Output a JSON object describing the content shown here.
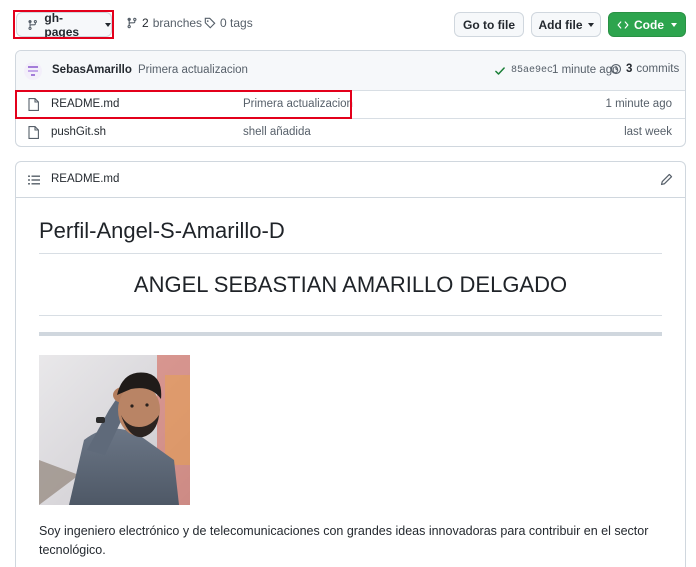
{
  "toolbar": {
    "branch": "gh-pages",
    "branches_count": "2",
    "branches_label": "branches",
    "tags_label": "0 tags",
    "go_to_file": "Go to file",
    "add_file": "Add file",
    "code": "Code"
  },
  "commit": {
    "author": "SebasAmarillo",
    "message": "Primera actualizacion",
    "hash": "85ae9ec",
    "time": "1 minute ago",
    "commits_count": "3",
    "commits_label": "commits"
  },
  "files": [
    {
      "name": "README.md",
      "message": "Primera actualizacion",
      "time": "1 minute ago"
    },
    {
      "name": "pushGit.sh",
      "message": "shell añadida",
      "time": "last week"
    }
  ],
  "readme": {
    "filename": "README.md",
    "title": "Perfil-Angel-S-Amarillo-D",
    "heading": "ANGEL SEBASTIAN AMARILLO DELGADO",
    "paragraph": "Soy ingeniero electrónico y de telecomunicaciones con grandes ideas innovadoras para contribuir en el sector tecnológico."
  },
  "colors": {
    "highlight": "#e3001b",
    "code_button": "#2da44e",
    "commit_check": "#1a7f37"
  }
}
